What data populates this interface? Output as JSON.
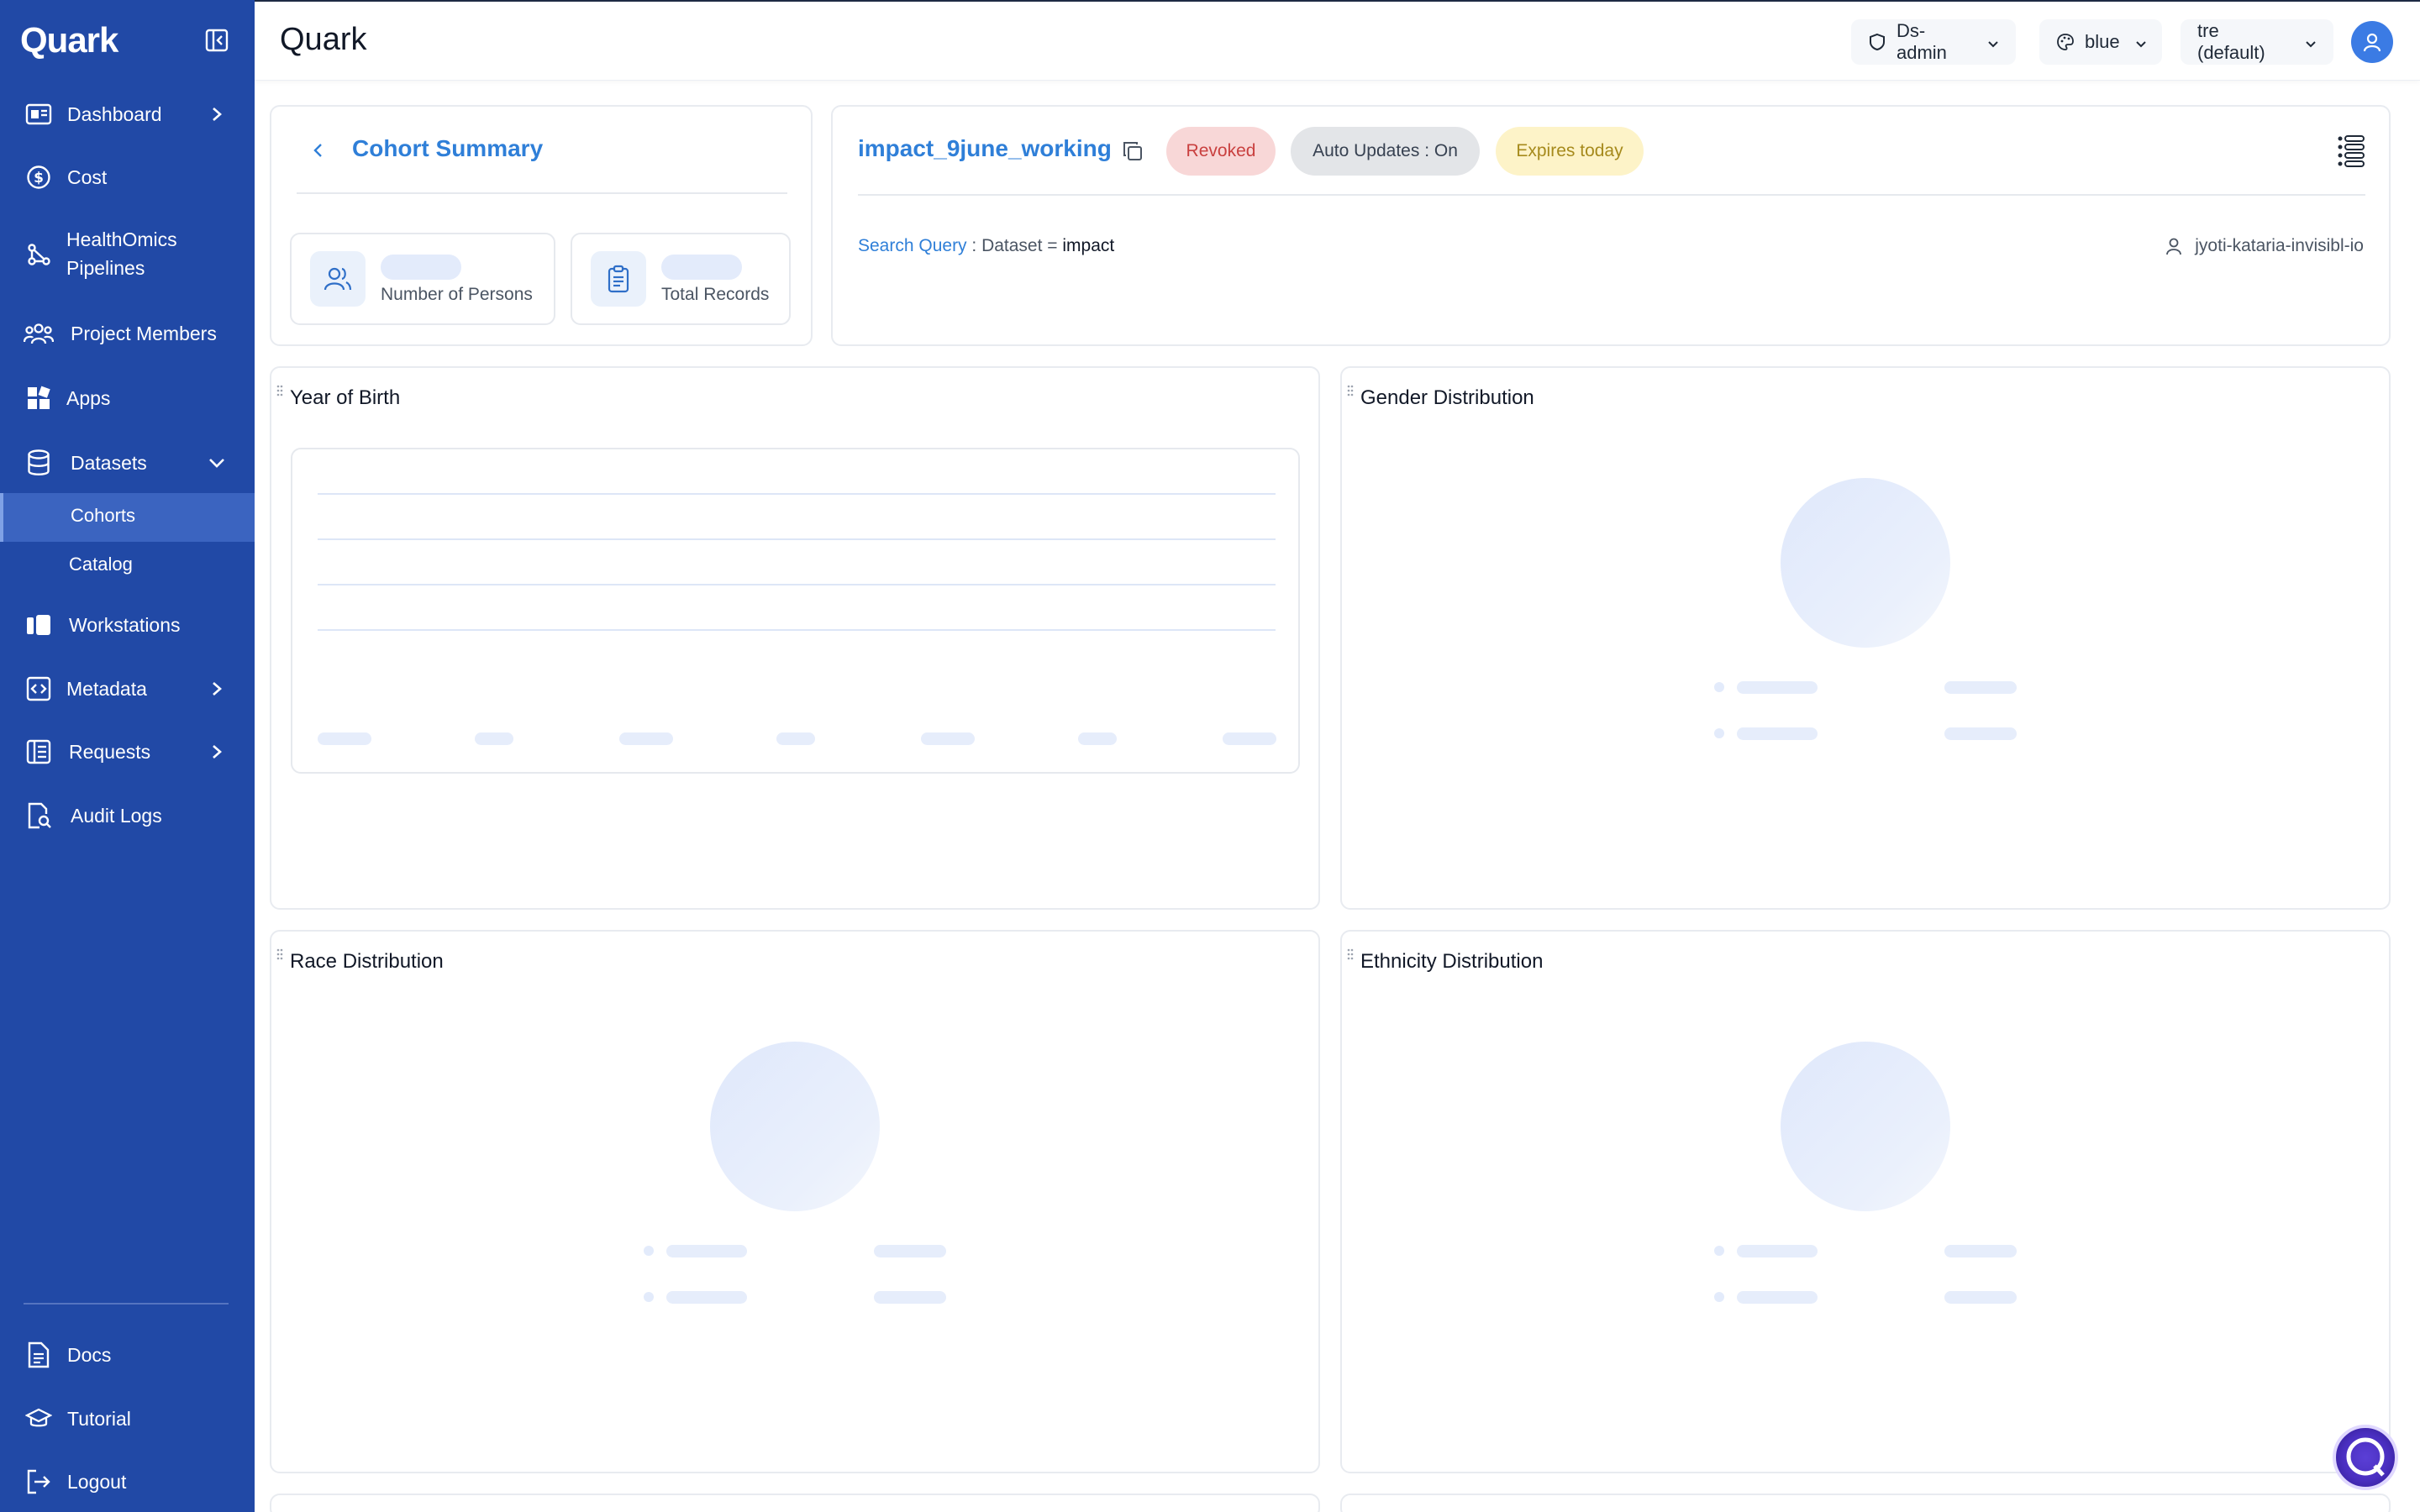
{
  "app": {
    "name": "Quark",
    "page_title": "Quark"
  },
  "sidebar": {
    "items": [
      {
        "label": "Dashboard",
        "icon": "dashboard-icon",
        "has_chevron": true
      },
      {
        "label": "Cost",
        "icon": "dollar-icon"
      },
      {
        "label": "HealthOmics Pipelines",
        "label_line1": "HealthOmics",
        "label_line2": "Pipelines",
        "icon": "pipeline-icon"
      },
      {
        "label": "Project Members",
        "icon": "members-icon"
      },
      {
        "label": "Apps",
        "icon": "apps-icon"
      },
      {
        "label": "Datasets",
        "icon": "database-icon",
        "expanded": true
      },
      {
        "label": "Workstations",
        "icon": "workstation-icon"
      },
      {
        "label": "Metadata",
        "icon": "code-icon",
        "has_chevron": true
      },
      {
        "label": "Requests",
        "icon": "requests-icon",
        "has_chevron": true
      },
      {
        "label": "Audit Logs",
        "icon": "audit-icon"
      }
    ],
    "subitems": [
      {
        "label": "Cohorts",
        "active": true
      },
      {
        "label": "Catalog",
        "active": false
      }
    ],
    "bottom": [
      {
        "label": "Docs",
        "icon": "docs-icon"
      },
      {
        "label": "Tutorial",
        "icon": "graduation-cap-icon"
      },
      {
        "label": "Logout",
        "icon": "logout-icon"
      }
    ]
  },
  "header": {
    "role": "Ds-admin",
    "theme": "blue",
    "workspace": "tre (default)"
  },
  "summary": {
    "title": "Cohort Summary",
    "stats": [
      {
        "label": "Number of Persons",
        "icon": "users-icon"
      },
      {
        "label": "Total Records",
        "icon": "clipboard-icon"
      }
    ]
  },
  "cohort": {
    "name": "impact_9june_working",
    "badges": {
      "revoked": "Revoked",
      "auto_updates": "Auto Updates : On",
      "expires": "Expires today"
    },
    "query_label": "Search Query",
    "query_sep": " : ",
    "query_field": "Dataset = ",
    "query_value": "impact",
    "owner": "jyoti-kataria-invisibl-io"
  },
  "panels": {
    "year_of_birth": "Year of Birth",
    "gender": "Gender Distribution",
    "race": "Race Distribution",
    "ethnicity": "Ethnicity Distribution"
  },
  "colors": {
    "sidebar_bg": "#2149a6",
    "accent": "#2f7fd8",
    "revoked_bg": "#f8d7d7",
    "revoked_fg": "#c9403f",
    "auto_bg": "#e3e5e8",
    "expires_bg": "#fdf3c8",
    "expires_fg": "#a68a1c"
  }
}
